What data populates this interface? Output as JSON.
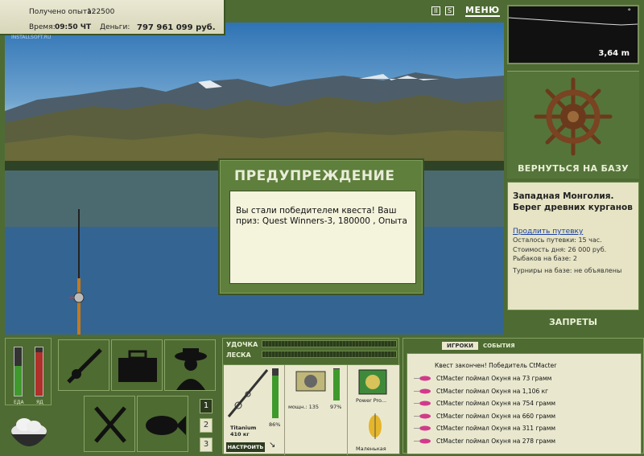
{
  "hud": {
    "experience_label": "Получено опыта:",
    "experience_value": "122500",
    "time_label": "Время:",
    "time_value": "09:50 ЧТ",
    "money_label": "Деньги:",
    "money_value": "797 961 099 руб.",
    "watermark": "INSTALLSOFT.RU",
    "pause_label": "II",
    "sound_label": "S",
    "menu_label": "МЕНЮ"
  },
  "depth": {
    "value": "3,64 m",
    "marker": "°"
  },
  "right": {
    "back_label": "ВЕРНУТЬСЯ НА БАЗУ",
    "location": "Западная Монголия. Берег древних курганов",
    "extend_link": "Продлить путевку",
    "lines": [
      "Осталось путевки: 15 час.",
      "Стоимость дня: 26 000 руб.",
      "Рыбаков на базе: 2",
      "Турниры на базе: не объявлены"
    ],
    "bans_label": "ЗАПРЕТЫ"
  },
  "modal": {
    "title": "ПРЕДУПРЕЖДЕНИЕ",
    "text": "Вы стали победителем квеста! Ваш приз: Quest Winners-3, 180000 , Опыта"
  },
  "bars": {
    "food_label": "ЕДА",
    "poison_label": "ЯД",
    "food_level": 0.62,
    "poison_level": 0.9
  },
  "pager": [
    "1",
    "2",
    "3"
  ],
  "tackle": {
    "rod_label": "УДОЧКА",
    "line_label": "ЛЕСКА",
    "rod_name": "Titanium",
    "rod_weight": "410 кг",
    "rod_percent": "86%",
    "reel_power": "мощн.: 135",
    "reel_percent": "97%",
    "line_name": "Power Pro...",
    "lure_name": "Маленькая",
    "setup_button": "НАСТРОИТЬ"
  },
  "chat": {
    "tab_players": "ИГРОКИ",
    "tab_events": "СОБЫТИЯ",
    "header": "Квест закончен! Победитель CtMacter",
    "messages": [
      "CtMacter поймал Окуня на 73 грамм",
      "CtMacter поймал Окуня на 1,106 кг",
      "CtMacter поймал Окуня на 754 грамм",
      "CtMacter поймал Окуня на 660 грамм",
      "CtMacter поймал Окуня на 311 грамм",
      "CtMacter поймал Окуня на 278 грамм"
    ]
  },
  "colors": {
    "panel": "#4e6b31",
    "cream": "#e9e8cf",
    "accent_red": "#b0302a",
    "accent_green": "#3f9a2c"
  }
}
